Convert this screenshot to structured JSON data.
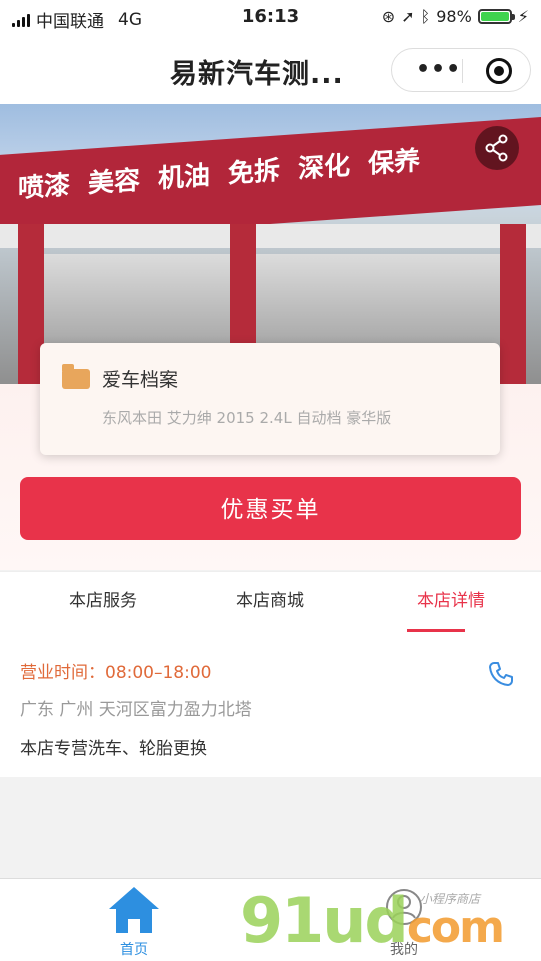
{
  "status_bar": {
    "carrier": "中国联通",
    "network": "4G",
    "time": "16:13",
    "battery": "98%",
    "battery_level": 0.98
  },
  "nav": {
    "title": "易新汽车测...",
    "more_icon": "more-dots-icon",
    "close_icon": "target-circle-icon"
  },
  "banner": {
    "shop_sign_words": [
      "喷漆",
      "美容",
      "机油",
      "免拆",
      "深化",
      "保养"
    ],
    "share_icon": "share-icon"
  },
  "car_card": {
    "title": "爱车档案",
    "subtitle": "东风本田 艾力绅 2015 2.4L 自动档 豪华版",
    "icon": "folder-icon"
  },
  "pay_button": {
    "label": "优惠买单",
    "color": "#e8334a"
  },
  "tabs": [
    {
      "label": "本店服务",
      "active": false
    },
    {
      "label": "本店商城",
      "active": false
    },
    {
      "label": "本店详情",
      "active": true
    }
  ],
  "details": {
    "hours": "营业时间：08:00–18:00",
    "address": "广东 广州 天河区富力盈力北塔",
    "description": "本店专营洗车、轮胎更换",
    "phone_icon": "phone-icon"
  },
  "bottom_bar": {
    "items": [
      {
        "label": "首页",
        "icon": "home-icon",
        "active": true
      },
      {
        "label": "我的",
        "icon": "user-icon",
        "active": false
      }
    ]
  },
  "watermark": {
    "main": "91ud",
    "suffix": "com",
    "small": "小程序商店"
  }
}
